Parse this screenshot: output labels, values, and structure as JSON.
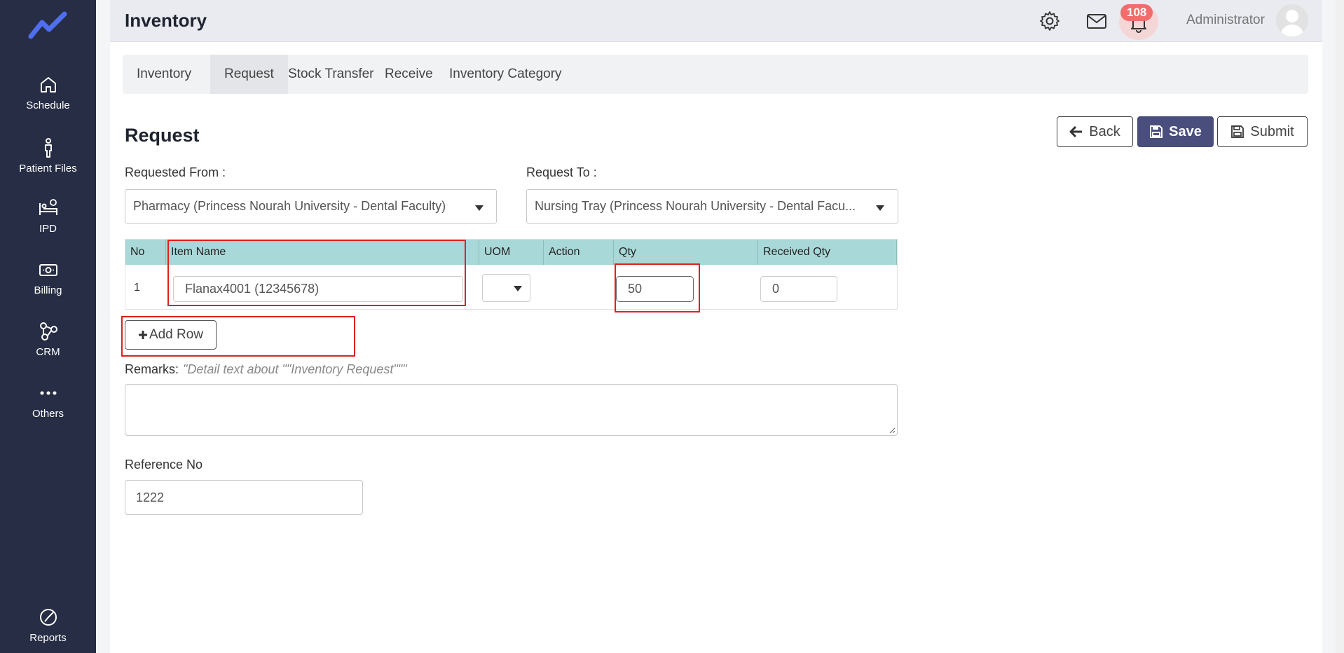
{
  "sidebar": {
    "items": [
      {
        "label": "Schedule",
        "icon": "home-icon"
      },
      {
        "label": "Patient Files",
        "icon": "person-icon"
      },
      {
        "label": "IPD",
        "icon": "bed-icon"
      },
      {
        "label": "Billing",
        "icon": "money-icon"
      },
      {
        "label": "CRM",
        "icon": "network-icon"
      },
      {
        "label": "Others",
        "icon": "more-icon"
      },
      {
        "label": "Reports",
        "icon": "chart-pie-icon"
      }
    ]
  },
  "header": {
    "title": "Inventory",
    "notification_count": "108",
    "user_name": "Administrator"
  },
  "tabs": [
    {
      "label": "Inventory"
    },
    {
      "label": "Request"
    },
    {
      "label": "Stock Transfer"
    },
    {
      "label": "Receive"
    },
    {
      "label": "Inventory Category"
    }
  ],
  "form": {
    "title": "Request",
    "back_label": "Back",
    "save_label": "Save",
    "submit_label": "Submit",
    "requested_from_label": "Requested From :",
    "requested_from_value": "Pharmacy (Princess Nourah University - Dental Faculty)",
    "request_to_label": "Request To :",
    "request_to_value": "Nursing Tray (Princess Nourah University - Dental Facu...",
    "table": {
      "headers": [
        "No",
        "Item Name",
        "UOM",
        "Action",
        "Qty",
        "Received Qty"
      ],
      "rows": [
        {
          "no": "1",
          "item_name": "Flanax4001 (12345678)",
          "uom": "",
          "qty": "50",
          "received_qty": "0"
        }
      ]
    },
    "add_row_label": "Add Row",
    "remarks_label": "Remarks:",
    "remarks_hint": "\"Detail text about \"\"Inventory Request\"\"\"",
    "reference_label": "Reference No",
    "reference_value": "1222"
  },
  "colors": {
    "sidebar_bg": "#262d44",
    "accent": "#4a4e7c",
    "table_header": "#a9d8d8",
    "highlight": "#e02020",
    "badge": "#f26c6c",
    "logo": "#4f6ef0"
  }
}
